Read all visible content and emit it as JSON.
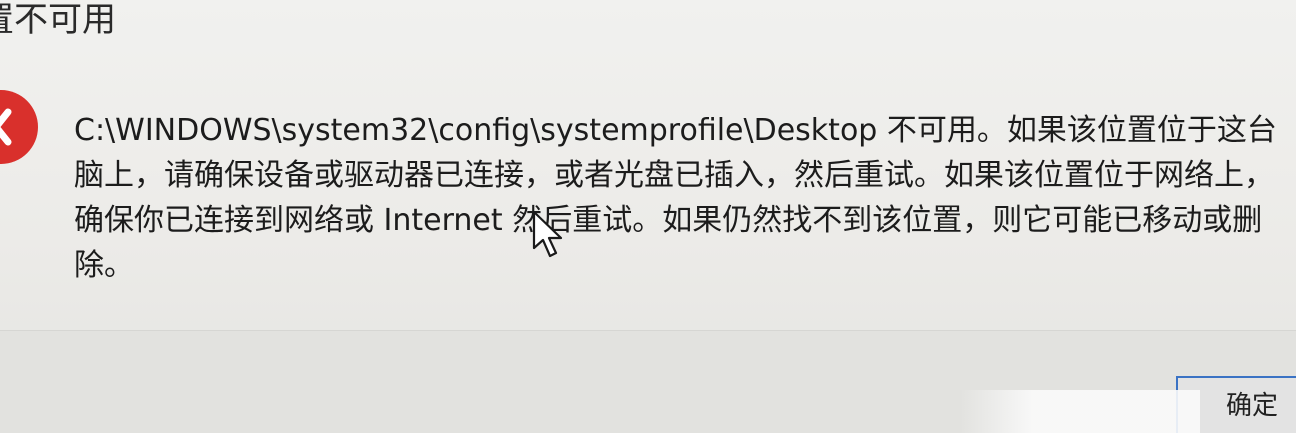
{
  "dialog": {
    "title": "置不可用",
    "icon": "error-icon",
    "accent_color": "#d9302c",
    "message_lines": [
      "C:\\WINDOWS\\system32\\config\\systemprofile\\Desktop 不可用。如果该位置位于这台",
      "脑上，请确保设备或驱动器已连接，或者光盘已插入，然后重试。如果该位置位于网络上，",
      "确保你已连接到网络或 Internet  然后重试。如果仍然找不到该位置，则它可能已移动或删",
      "除。"
    ],
    "ok_button_label": "确定"
  }
}
